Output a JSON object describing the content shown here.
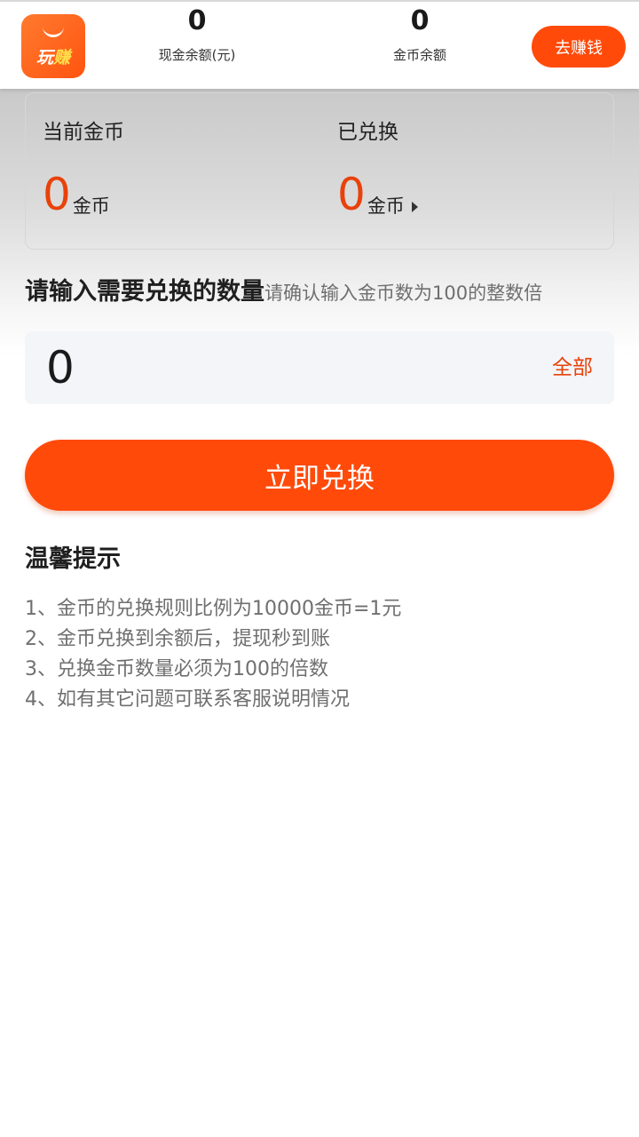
{
  "header": {
    "logo_text_part1": "玩",
    "logo_text_part2": "赚",
    "cash_balance": {
      "value": "0",
      "label": "现金余额(元)"
    },
    "coin_balance": {
      "value": "0",
      "label": "金币余额"
    },
    "earn_button_label": "去赚钱"
  },
  "summary": {
    "current": {
      "title": "当前金币",
      "value": "0",
      "unit": "金币"
    },
    "exchanged": {
      "title": "已兑换",
      "value": "0",
      "unit": "金币"
    }
  },
  "prompt": {
    "main": "请输入需要兑换的数量",
    "sub": "请确认输入金币数为100的整数倍"
  },
  "amount_input": {
    "value": "0",
    "all_label": "全部"
  },
  "exchange_button_label": "立即兑换",
  "tips": {
    "title": "温馨提示",
    "items": [
      "1、金币的兑换规则比例为10000金币=1元",
      "2、金币兑换到余额后，提现秒到账",
      "3、兑换金币数量必须为100的倍数",
      "4、如有其它问题可联系客服说明情况"
    ]
  },
  "colors": {
    "accent": "#ff4a0a",
    "value_orange": "#e8420a",
    "input_bg": "#f4f5f9"
  }
}
